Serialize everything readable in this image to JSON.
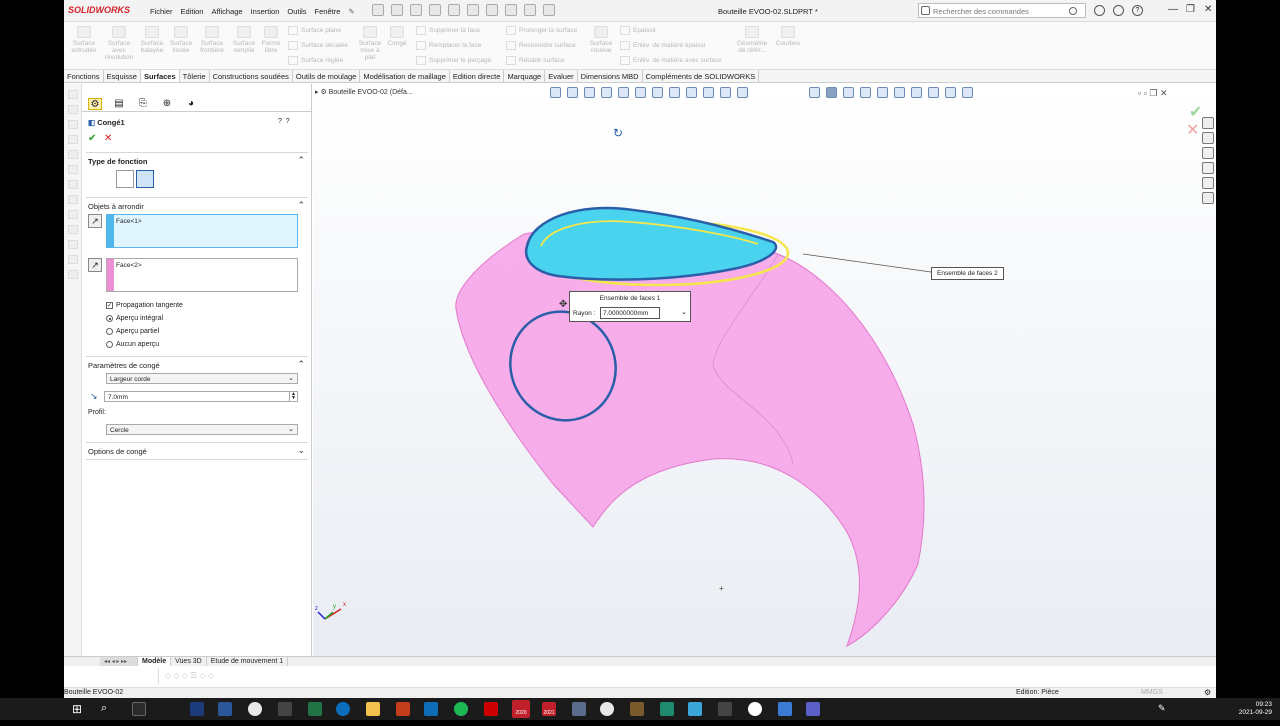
{
  "app": {
    "name": "SOLIDWORKS",
    "document_title": "Bouteille EVOO-02.SLDPRT *",
    "search_placeholder": "Rechercher des commandes"
  },
  "menu": [
    "Fichier",
    "Edition",
    "Affichage",
    "Insertion",
    "Outils",
    "Fenêtre"
  ],
  "ribbon": {
    "large_buttons": [
      {
        "label": "Surface extrudée"
      },
      {
        "label": "Surface avec révolution"
      },
      {
        "label": "Surface balayée"
      },
      {
        "label": "Surface lissée"
      },
      {
        "label": "Surface frontière"
      },
      {
        "label": "Surface remplie"
      },
      {
        "label": "Forme libre"
      },
      {
        "label": "Surface mise à plat"
      },
      {
        "label": "Congé"
      },
      {
        "label": "Surface couvue"
      },
      {
        "label": "Géométrie de référ..."
      },
      {
        "label": "Courbes"
      }
    ],
    "small_buttons": [
      "Surface plane",
      "Surface décalée",
      "Surface réglée",
      "Supprimer la face",
      "Remplacer la face",
      "Supprimer le perçage",
      "Prolonger la surface",
      "Restreindre surface",
      "Rétablir surface",
      "Epaissir",
      "Enlèv. de matière épaissi",
      "Enlèv. de matière avec surface"
    ]
  },
  "tabs": [
    {
      "label": "Fonctions",
      "active": false
    },
    {
      "label": "Esquisse",
      "active": false
    },
    {
      "label": "Surfaces",
      "active": true
    },
    {
      "label": "Tôlerie",
      "active": false
    },
    {
      "label": "Constructions soudées",
      "active": false
    },
    {
      "label": "Outils de moulage",
      "active": false
    },
    {
      "label": "Modélisation de maillage",
      "active": false
    },
    {
      "label": "Edition directe",
      "active": false
    },
    {
      "label": "Marquage",
      "active": false
    },
    {
      "label": "Evaluer",
      "active": false
    },
    {
      "label": "Dimensions MBD",
      "active": false
    },
    {
      "label": "Compléments de SOLIDWORKS",
      "active": false
    }
  ],
  "property_manager": {
    "feature_name": "Congé1",
    "ok_glyph": "✔",
    "cancel_glyph": "✕",
    "type_section": "Type de fonction",
    "objects_section": "Objets à arrondir",
    "face1": "Face<1>",
    "face2": "Face<2>",
    "face1_color": "#4fb6ec",
    "face2_color": "#ef8ed4",
    "propagation": "Propagation tangente",
    "preview_full": "Aperçu intégral",
    "preview_partial": "Aperçu partiel",
    "preview_none": "Aucun aperçu",
    "params_section": "Paramètres de congé",
    "method": "Largeur corde",
    "distance": "7.0mm",
    "profile_label": "Profil:",
    "profile": "Cercle",
    "options_section": "Options de congé"
  },
  "viewport": {
    "breadcrumb": "Bouteille EVOO-02  (Défa...",
    "callout_faceset2": "Ensemble de faces 2",
    "callout_faceset1": "Ensemble de faces 1",
    "radius_label": "Rayon",
    "radius_value": "7.00000000mm",
    "body_color": "#f7a0e6",
    "edge_color": "#2b5ea8",
    "top_face_color": "#49d3ef",
    "fillet_preview_color": "#f4e64b",
    "triad_labels": [
      "x",
      "y",
      "z"
    ]
  },
  "bottom_tabs": [
    {
      "label": "Modèle",
      "active": true
    },
    {
      "label": "Vues 3D",
      "active": false
    },
    {
      "label": "Etude de mouvement 1",
      "active": false
    }
  ],
  "status": {
    "left": "Bouteille EVOO-02",
    "mode": "Edition: Pièce",
    "units": "MMGS"
  },
  "taskbar": {
    "time": "09:23",
    "date": "2021-09-29",
    "labels": [
      "2020",
      "2021"
    ]
  }
}
